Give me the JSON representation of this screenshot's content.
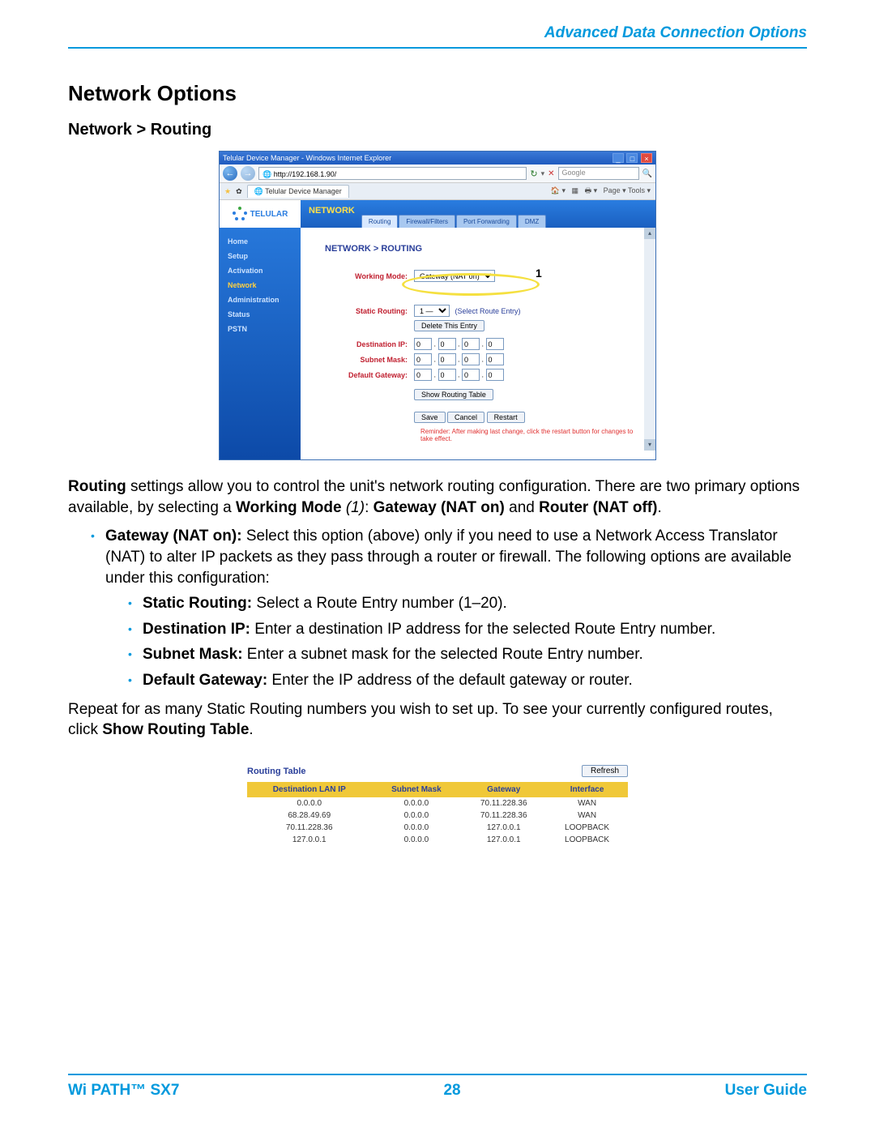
{
  "header": {
    "section_title": "Advanced Data Connection Options"
  },
  "headings": {
    "h1": "Network Options",
    "h2": "Network > Routing"
  },
  "screenshot": {
    "window_title": "Telular Device Manager - Windows Internet Explorer",
    "address": "http://192.168.1.90/",
    "search_placeholder": "Google",
    "tab_label": "Telular Device Manager",
    "tool_labels": "Page ▾   Tools ▾",
    "brand": "TELULAR",
    "section": "NETWORK",
    "inner_tabs": [
      "Routing",
      "Firewall/Filters",
      "Port Forwarding",
      "DMZ"
    ],
    "sidebar": [
      "Home",
      "Setup",
      "Activation",
      "Network",
      "Administration",
      "Status",
      "PSTN"
    ],
    "panel_title": "NETWORK > ROUTING",
    "callout": "1",
    "labels": {
      "working_mode": "Working Mode:",
      "static_routing": "Static Routing:",
      "destination_ip": "Destination IP:",
      "subnet_mask": "Subnet Mask:",
      "default_gateway": "Default Gateway:"
    },
    "values": {
      "working_mode": "Gateway (NAT on)",
      "static_routing": "1 —",
      "select_hint": "(Select Route Entry)",
      "ip_oct": "0"
    },
    "buttons": {
      "delete": "Delete This Entry",
      "show": "Show Routing Table",
      "save": "Save",
      "cancel": "Cancel",
      "restart": "Restart"
    },
    "reminder": "Reminder: After making last change, click the restart button for changes to take effect."
  },
  "body": {
    "p1_a": "Routing",
    "p1_b": " settings allow you to control the unit's network routing configuration. There are two primary options available, by selecting a ",
    "p1_c": "Working Mode",
    "p1_d": " (1)",
    "p1_e": ": ",
    "p1_f": "Gateway (NAT on)",
    "p1_g": " and ",
    "p1_h": "Router (NAT off)",
    "p1_i": ".",
    "li1_a": "Gateway (NAT on):",
    "li1_b": " Select this option (above) only if you need to use a Network Access Translator (NAT) to alter IP packets as they pass through a router or firewall. The following options are available under this configuration:",
    "sli1_a": "Static Routing:",
    "sli1_b": " Select a Route Entry number (1–20).",
    "sli2_a": "Destination IP:",
    "sli2_b": " Enter a destination IP address for the selected Route Entry number.",
    "sli3_a": "Subnet Mask:",
    "sli3_b": " Enter a subnet mask for the selected Route Entry number.",
    "sli4_a": "Default Gateway:",
    "sli4_b": " Enter the IP address of the default gateway or router.",
    "p2_a": "Repeat for as many Static Routing numbers you wish to set up. To see your currently configured routes, click ",
    "p2_b": "Show Routing Table",
    "p2_c": "."
  },
  "routing_table": {
    "title": "Routing Table",
    "refresh": "Refresh",
    "headers": [
      "Destination LAN IP",
      "Subnet Mask",
      "Gateway",
      "Interface"
    ],
    "rows": [
      [
        "0.0.0.0",
        "0.0.0.0",
        "70.11.228.36",
        "WAN"
      ],
      [
        "68.28.49.69",
        "0.0.0.0",
        "70.11.228.36",
        "WAN"
      ],
      [
        "70.11.228.36",
        "0.0.0.0",
        "127.0.0.1",
        "LOOPBACK"
      ],
      [
        "127.0.0.1",
        "0.0.0.0",
        "127.0.0.1",
        "LOOPBACK"
      ]
    ]
  },
  "footer": {
    "left": "Wi PATH™ SX7",
    "center": "28",
    "right": "User Guide"
  }
}
